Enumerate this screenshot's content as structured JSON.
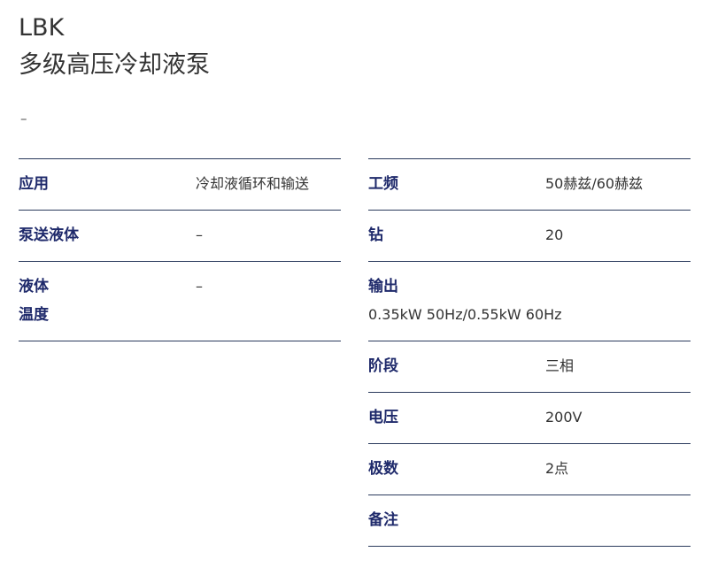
{
  "product": {
    "model": "LBK",
    "name": "多级高压冷却液泵",
    "subtitle": "–"
  },
  "left_specs": [
    {
      "label": "应用",
      "value": "冷却液循环和输送"
    },
    {
      "label": "泵送液体",
      "value": "–"
    },
    {
      "label": "液体温度",
      "label_line1": "液体",
      "label_line2": "温度",
      "value": "–"
    }
  ],
  "right_specs": [
    {
      "label": "工频",
      "value": "50赫兹/60赫兹"
    },
    {
      "label": "钻",
      "value": "20"
    },
    {
      "label": "输出",
      "value": "0.35kW 50Hz/0.55kW 60Hz"
    },
    {
      "label": "阶段",
      "value": "三相"
    },
    {
      "label": "电压",
      "value": "200V"
    },
    {
      "label": "极数",
      "value": "2点"
    },
    {
      "label": "备注",
      "value": ""
    }
  ],
  "colors": {
    "label_text": "#1f2a6b",
    "divider": "#2a3a5c",
    "body_text": "#333333"
  }
}
